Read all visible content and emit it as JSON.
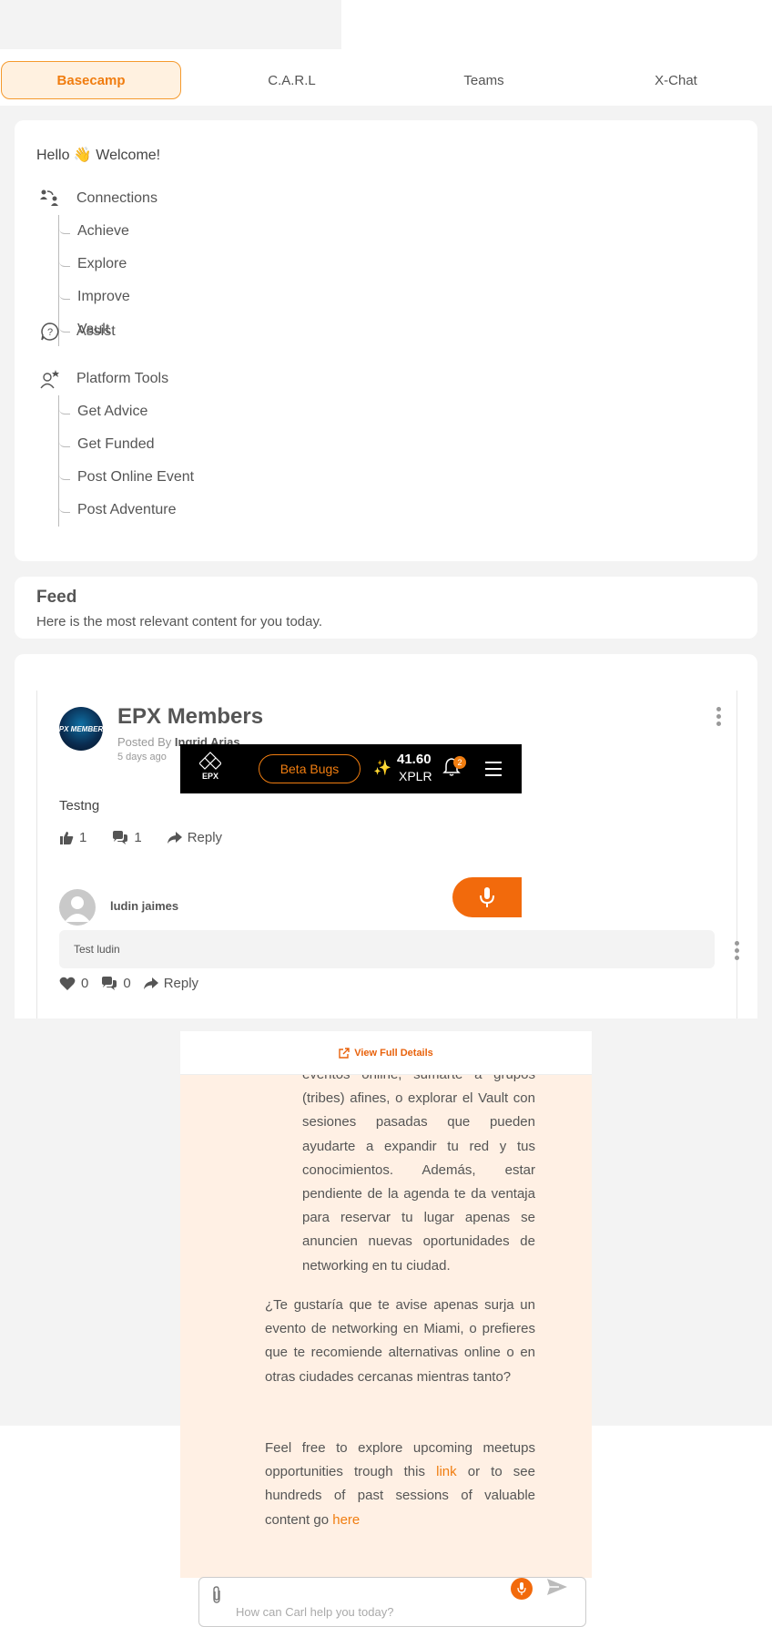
{
  "tabs": [
    {
      "label": "Basecamp",
      "active": true
    },
    {
      "label": "C.A.R.L"
    },
    {
      "label": "Teams"
    },
    {
      "label": "X-Chat"
    }
  ],
  "sidebar": {
    "greeting": "Hello 👋 Welcome!",
    "connections": {
      "label": "Connections",
      "icon": "connections-icon",
      "items": [
        "Achieve",
        "Explore",
        "Improve",
        "Vault"
      ]
    },
    "assist": {
      "label": "Assist",
      "icon": "question-bubble-icon"
    },
    "platform_tools": {
      "label": "Platform Tools",
      "icon": "user-gear-icon",
      "items": [
        "Get Advice",
        "Get Funded",
        "Post Online Event",
        "Post Adventure"
      ]
    }
  },
  "feed": {
    "title": "Feed",
    "subtitle": "Here is the most relevant content for you today."
  },
  "post": {
    "author_group": "EPX Members",
    "avatar_text": "EPX MEMBERS",
    "posted_by_label": "Posted By",
    "posted_by_name": "Ingrid Arias",
    "date": "5 days ago",
    "text": "Testng",
    "likes": "1",
    "comments": "1",
    "reply_label": "Reply",
    "comment": {
      "author": "ludin jaimes",
      "text": "Test ludin",
      "likes": "0",
      "replies": "0",
      "reply_label": "Reply"
    }
  },
  "epx_bar": {
    "logo_text": "EPX",
    "beta_button": "Beta Bugs",
    "xplr_value": "41.60",
    "xplr_label": "XPLR",
    "notification_count": "2"
  },
  "chat": {
    "view_full_details": "View Full Details",
    "para1": "eventos online, sumarte a grupos (tribes) afines, o explorar el Vault con sesiones pasadas que pueden ayudarte a expandir tu red y tus conocimientos. Además, estar pendiente de la agenda te da ventaja para reservar tu lugar apenas se anuncien nuevas oportunidades de networking en tu ciudad.",
    "para2": "¿Te gustaría que te avise apenas surja un evento de networking en Miami, o prefieres que te recomiende alternativas online o en otras ciudades cercanas mientras tanto?",
    "para3_a": "Feel free to explore upcoming meetups opportunities trough this ",
    "para3_link1": "link",
    "para3_b": " or to see hundreds of past sessions of valuable content go ",
    "para3_link2": "here",
    "input_placeholder": "How can Carl help you today?"
  },
  "colors": {
    "accent": "#f07d10",
    "panel_bg": "#fff0e4",
    "page_bg": "#f3f3f3"
  }
}
